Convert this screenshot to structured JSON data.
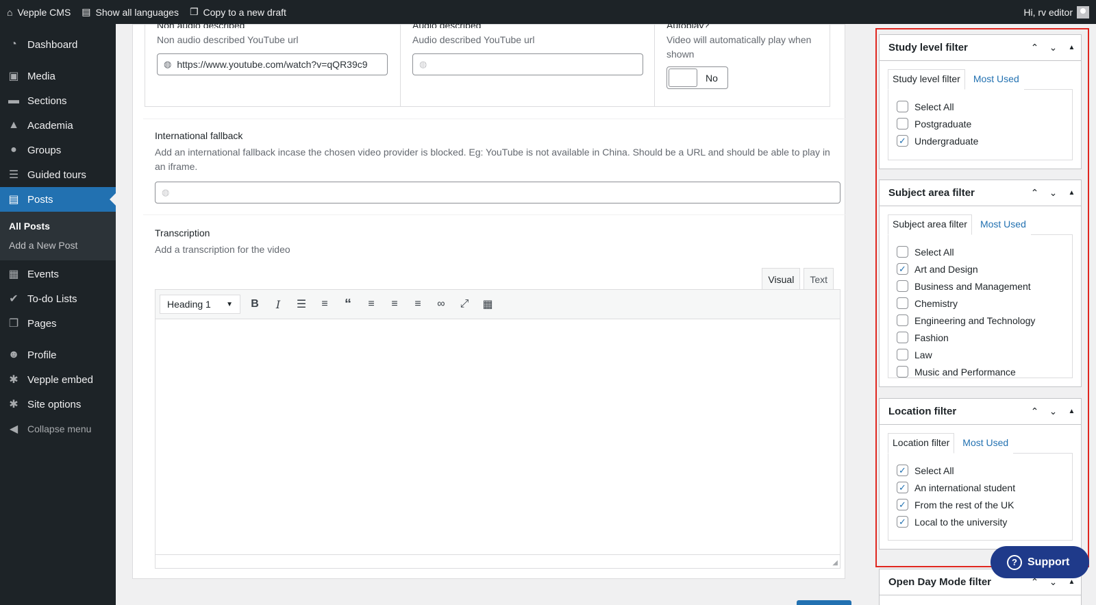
{
  "adminbar": {
    "site_name": "Vepple CMS",
    "languages": "Show all languages",
    "copy_draft": "Copy to a new draft",
    "greeting": "Hi, rv editor"
  },
  "sidebar": {
    "items": [
      {
        "label": "Dashboard",
        "icon": "dashboard-icon"
      },
      {
        "label": "Media",
        "icon": "media-icon"
      },
      {
        "label": "Sections",
        "icon": "folder-icon"
      },
      {
        "label": "Academia",
        "icon": "graduation-cap-icon"
      },
      {
        "label": "Groups",
        "icon": "location-pin-icon"
      },
      {
        "label": "Guided tours",
        "icon": "list-icon"
      },
      {
        "label": "Posts",
        "icon": "posts-icon"
      },
      {
        "label": "Events",
        "icon": "calendar-icon"
      },
      {
        "label": "To-do Lists",
        "icon": "check-circle-icon"
      },
      {
        "label": "Pages",
        "icon": "pages-icon"
      },
      {
        "label": "Profile",
        "icon": "user-icon"
      },
      {
        "label": "Vepple embed",
        "icon": "gear-icon"
      },
      {
        "label": "Site options",
        "icon": "gear-icon"
      }
    ],
    "submenu": {
      "all_posts": "All Posts",
      "add_new": "Add a New Post"
    },
    "collapse": "Collapse menu"
  },
  "video": {
    "col1": {
      "label": "Non audio described",
      "desc": "Non audio described YouTube url",
      "value": "https://www.youtube.com/watch?v=qQR39c9"
    },
    "col2": {
      "label": "Audio described",
      "desc": "Audio described YouTube url",
      "value": ""
    },
    "col3": {
      "label": "Autoplay?",
      "desc": "Video will automatically play when shown",
      "toggle": "No"
    }
  },
  "fallback": {
    "label": "International fallback",
    "desc": "Add an international fallback incase the chosen video provider is blocked. Eg: YouTube is not available in China. Should be a URL and should be able to play in an iframe."
  },
  "transcription": {
    "label": "Transcription",
    "desc": "Add a transcription for the video",
    "tab_visual": "Visual",
    "tab_text": "Text",
    "format": "Heading 1"
  },
  "filters": {
    "study": {
      "title": "Study level filter",
      "tab": "Study level filter",
      "most_used": "Most Used",
      "options": [
        {
          "label": "Select All",
          "checked": false
        },
        {
          "label": "Postgraduate",
          "checked": false
        },
        {
          "label": "Undergraduate",
          "checked": true
        }
      ]
    },
    "subject": {
      "title": "Subject area filter",
      "tab": "Subject area filter",
      "most_used": "Most Used",
      "options": [
        {
          "label": "Select All",
          "checked": false
        },
        {
          "label": "Art and Design",
          "checked": true
        },
        {
          "label": "Business and Management",
          "checked": false
        },
        {
          "label": "Chemistry",
          "checked": false
        },
        {
          "label": "Engineering and Technology",
          "checked": false
        },
        {
          "label": "Fashion",
          "checked": false
        },
        {
          "label": "Law",
          "checked": false
        },
        {
          "label": "Music and Performance",
          "checked": false
        }
      ]
    },
    "location": {
      "title": "Location filter",
      "tab": "Location filter",
      "most_used": "Most Used",
      "options": [
        {
          "label": "Select All",
          "checked": true
        },
        {
          "label": "An international student",
          "checked": true
        },
        {
          "label": "From the rest of the UK",
          "checked": true
        },
        {
          "label": "Local to the university",
          "checked": true
        }
      ]
    },
    "openday": {
      "title": "Open Day Mode filter"
    }
  },
  "support": {
    "label": "Support"
  }
}
